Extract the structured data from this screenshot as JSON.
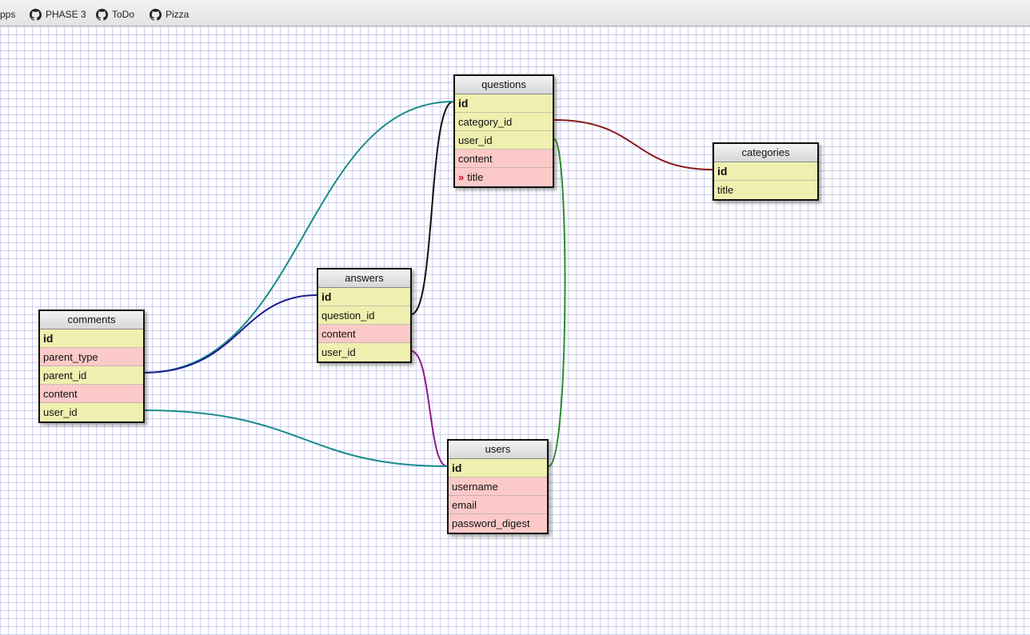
{
  "bookmarks": [
    {
      "label": "pps",
      "icon": "none"
    },
    {
      "label": "PHASE 3",
      "icon": "github-icon"
    },
    {
      "label": "ToDo",
      "icon": "github-icon"
    },
    {
      "label": "Pizza",
      "icon": "github-icon"
    }
  ],
  "tables": {
    "questions": {
      "name": "questions",
      "fields": [
        {
          "name": "id",
          "kind": "key"
        },
        {
          "name": "category_id",
          "kind": "fk"
        },
        {
          "name": "user_id",
          "kind": "fk"
        },
        {
          "name": "content",
          "kind": "plain"
        },
        {
          "name": "title",
          "kind": "plain",
          "marker": "»"
        }
      ]
    },
    "categories": {
      "name": "categories",
      "fields": [
        {
          "name": "id",
          "kind": "key"
        },
        {
          "name": "title",
          "kind": "fk"
        }
      ]
    },
    "answers": {
      "name": "answers",
      "fields": [
        {
          "name": "id",
          "kind": "key"
        },
        {
          "name": "question_id",
          "kind": "fk"
        },
        {
          "name": "content",
          "kind": "plain"
        },
        {
          "name": "user_id",
          "kind": "fk"
        }
      ]
    },
    "comments": {
      "name": "comments",
      "fields": [
        {
          "name": "id",
          "kind": "key"
        },
        {
          "name": "parent_type",
          "kind": "plain"
        },
        {
          "name": "parent_id",
          "kind": "fk"
        },
        {
          "name": "content",
          "kind": "plain"
        },
        {
          "name": "user_id",
          "kind": "fk"
        }
      ]
    },
    "users": {
      "name": "users",
      "fields": [
        {
          "name": "id",
          "kind": "key"
        },
        {
          "name": "username",
          "kind": "plain"
        },
        {
          "name": "email",
          "kind": "plain"
        },
        {
          "name": "password_digest",
          "kind": "plain"
        }
      ]
    }
  },
  "relations": [
    {
      "from": "questions.category_id",
      "to": "categories.id",
      "color": "#8b1a1a"
    },
    {
      "from": "questions.user_id",
      "to": "users.id",
      "color": "#2e8b2e"
    },
    {
      "from": "answers.question_id",
      "to": "questions.id",
      "color": "#111111"
    },
    {
      "from": "answers.user_id",
      "to": "users.id",
      "color": "#8a1a8a"
    },
    {
      "from": "comments.parent_id",
      "to": "questions.id",
      "color": "#1a8a8a"
    },
    {
      "from": "comments.parent_id",
      "to": "answers.id",
      "color": "#1a1a8a"
    },
    {
      "from": "comments.user_id",
      "to": "users.id",
      "color": "#1a8a8a"
    }
  ]
}
